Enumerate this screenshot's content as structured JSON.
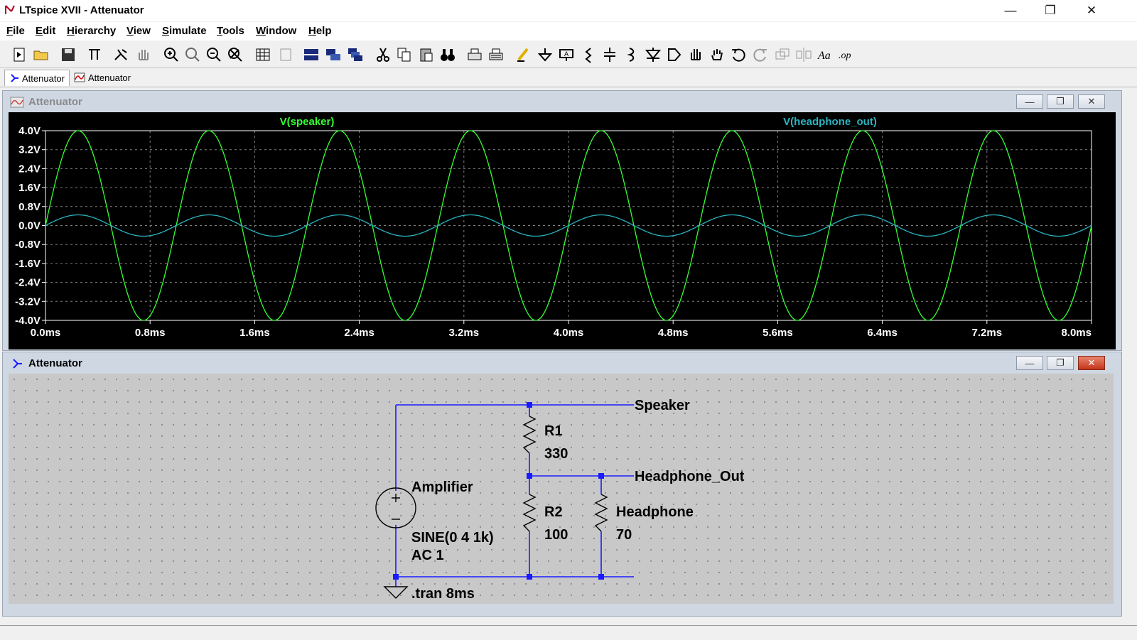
{
  "window": {
    "title": "LTspice XVII - Attenuator",
    "controls": [
      "—",
      "❐",
      "✕"
    ]
  },
  "menu": [
    "File",
    "Edit",
    "Hierarchy",
    "View",
    "Simulate",
    "Tools",
    "Window",
    "Help"
  ],
  "tabs": [
    {
      "label": "Attenuator",
      "icon": "schematic-icon",
      "active": true
    },
    {
      "label": "Attenuator",
      "icon": "waveform-icon",
      "active": false
    }
  ],
  "waveform_window": {
    "title": "Attenuator",
    "controls": [
      "—",
      "❐",
      "✕"
    ]
  },
  "schematic_window": {
    "title": "Attenuator",
    "controls": [
      "—",
      "❐",
      "✕"
    ],
    "labels": {
      "net_speaker": "Speaker",
      "net_headphone": "Headphone_Out",
      "r1_name": "R1",
      "r1_value": "330",
      "r2_name": "R2",
      "r2_value": "100",
      "rl_name": "Headphone",
      "rl_value": "70",
      "source_name": "Amplifier",
      "source_value": "SINE(0 4 1k)",
      "source_ac": "AC 1",
      "directive": ".tran 8ms"
    }
  },
  "chart_data": {
    "type": "line",
    "x_unit": "ms",
    "xlim": [
      0,
      8
    ],
    "ylim": [
      -4,
      4
    ],
    "x_ticks": [
      "0.0ms",
      "0.8ms",
      "1.6ms",
      "2.4ms",
      "3.2ms",
      "4.0ms",
      "4.8ms",
      "5.6ms",
      "6.4ms",
      "7.2ms",
      "8.0ms"
    ],
    "y_ticks": [
      "4.0V",
      "3.2V",
      "2.4V",
      "1.6V",
      "0.8V",
      "0.0V",
      "-0.8V",
      "-1.6V",
      "-2.4V",
      "-3.2V",
      "-4.0V"
    ],
    "grid": true,
    "series": [
      {
        "name": "V(speaker)",
        "color": "#33ff33",
        "amplitude": 4.0,
        "frequency_khz": 1
      },
      {
        "name": "V(headphone_out)",
        "color": "#2ab4c0",
        "amplitude": 0.45,
        "frequency_khz": 1
      }
    ]
  },
  "colors": {
    "wire": "#1a1aff",
    "plot_bg": "#000000",
    "grid": "#808080"
  }
}
